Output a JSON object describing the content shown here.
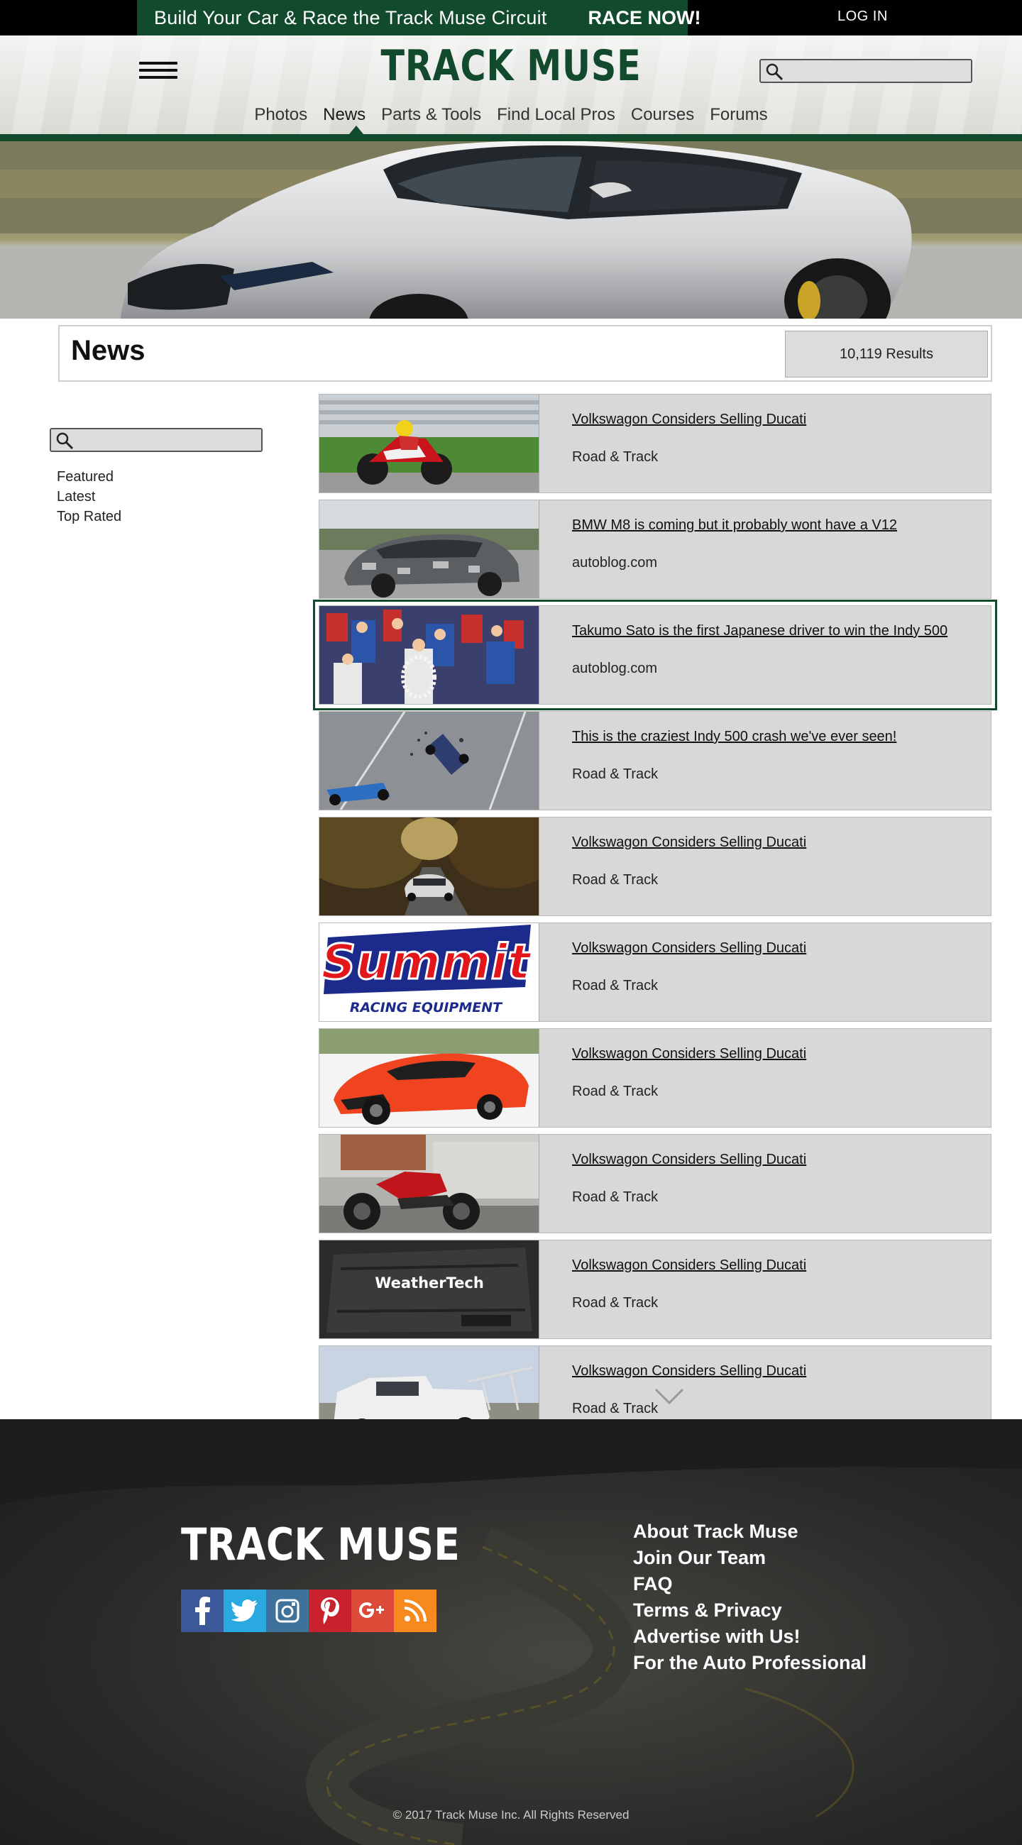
{
  "promo": {
    "text": "Build Your Car & Race the Track Muse Circuit",
    "cta": "RACE NOW!"
  },
  "login_label": "LOG IN",
  "brand": {
    "name": "TRACK MUSE",
    "color": "#114a2c"
  },
  "nav": {
    "items": [
      "Photos",
      "News",
      "Parts & Tools",
      "Find Local Pros",
      "Courses",
      "Forums"
    ],
    "active": "News"
  },
  "news": {
    "title": "News",
    "results": "10,119 Results"
  },
  "sidebar": {
    "filters": [
      "Featured",
      "Latest",
      "Top Rated"
    ]
  },
  "articles": [
    {
      "headline": "Volkswagon Considers Selling Ducati",
      "source": "Road & Track"
    },
    {
      "headline": "BMW M8 is coming but it probably wont have a V12",
      "source": "autoblog.com"
    },
    {
      "headline": "Takumo Sato is the first Japanese driver to win the Indy 500",
      "source": "autoblog.com",
      "selected": true
    },
    {
      "headline": "This is the craziest Indy 500 crash we've ever seen!",
      "source": "Road & Track"
    },
    {
      "headline": "Volkswagon Considers Selling Ducati",
      "source": "Road & Track"
    },
    {
      "headline": "Volkswagon Considers Selling Ducati",
      "source": "Road & Track"
    },
    {
      "headline": "Volkswagon Considers Selling Ducati",
      "source": "Road & Track"
    },
    {
      "headline": "Volkswagon Considers Selling Ducati",
      "source": "Road & Track"
    },
    {
      "headline": "Volkswagon Considers Selling Ducati",
      "source": "Road & Track"
    },
    {
      "headline": "Volkswagon Considers Selling Ducati",
      "source": "Road & Track"
    }
  ],
  "thumbnail_text": {
    "summit": "Summit",
    "summit_sub": "RACING EQUIPMENT",
    "weathertech": "WeatherTech"
  },
  "footer": {
    "logo": "TRACK MUSE",
    "links": [
      "About Track Muse",
      "Join Our Team",
      "FAQ",
      "Terms & Privacy",
      "Advertise with Us!",
      "For the Auto Professional"
    ],
    "social": [
      "facebook-icon",
      "twitter-icon",
      "instagram-icon",
      "pinterest-icon",
      "google-plus-icon",
      "rss-icon"
    ],
    "copyright": "© 2017 Track Muse Inc. All Rights Reserved"
  }
}
